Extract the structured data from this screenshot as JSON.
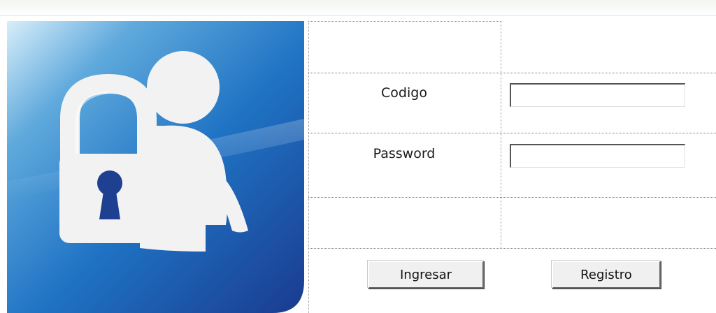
{
  "form": {
    "code_label": "Codigo",
    "code_value": "",
    "password_label": "Password",
    "password_value": "",
    "login_button": "Ingresar",
    "register_button": "Registro"
  },
  "colors": {
    "tile_blue_dark": "#1b3f95",
    "tile_blue_light": "#cfe7f7",
    "icon_white": "#f2f2f2",
    "keyhole": "#1f4090"
  },
  "icons": {
    "tile": "user-lock-icon",
    "lock": "padlock-icon",
    "keyhole": "keyhole-icon",
    "user": "user-silhouette-icon"
  }
}
